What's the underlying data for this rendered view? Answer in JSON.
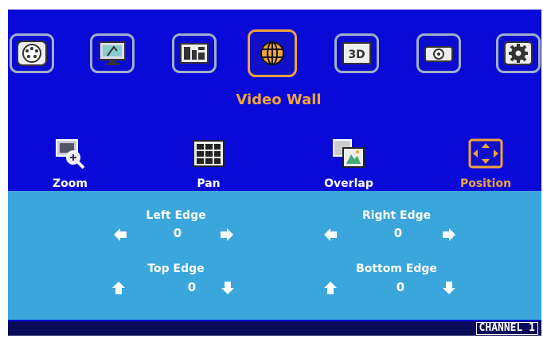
{
  "menu": {
    "title": "Video Wall",
    "top_icons": [
      "input-icon",
      "display-icon",
      "audio-icon",
      "video-wall-icon",
      "3d-icon",
      "projector-icon",
      "settings-icon"
    ],
    "selected_top_index": 3
  },
  "submenu": {
    "items": [
      {
        "label": "Zoom",
        "icon": "zoom-icon"
      },
      {
        "label": "Pan",
        "icon": "pan-icon"
      },
      {
        "label": "Overlap",
        "icon": "overlap-icon"
      },
      {
        "label": "Position",
        "icon": "position-icon"
      }
    ],
    "selected_index": 3
  },
  "position": {
    "left_edge": {
      "label": "Left Edge",
      "value": "0"
    },
    "right_edge": {
      "label": "Right Edge",
      "value": "0"
    },
    "top_edge": {
      "label": "Top Edge",
      "value": "0"
    },
    "bottom_edge": {
      "label": "Bottom Edge",
      "value": "0"
    }
  },
  "status": {
    "channel": "CHANNEL 1"
  },
  "colors": {
    "background": "#0a0ad8",
    "accent": "#f2a23c",
    "panel": "#3aa6dc",
    "text": "#ffffff"
  }
}
